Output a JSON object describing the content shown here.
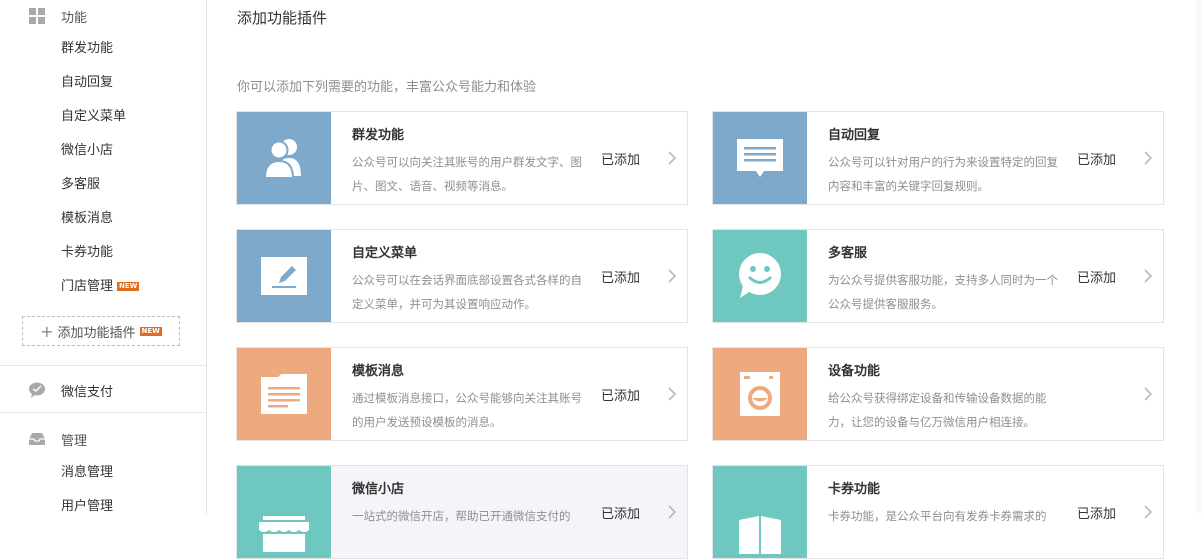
{
  "sidebar": {
    "features_title": "功能",
    "items": [
      {
        "label": "群发功能"
      },
      {
        "label": "自动回复"
      },
      {
        "label": "自定义菜单"
      },
      {
        "label": "微信小店"
      },
      {
        "label": "多客服"
      },
      {
        "label": "模板消息"
      },
      {
        "label": "卡券功能"
      },
      {
        "label": "门店管理",
        "badge": "NEW"
      }
    ],
    "add_plugin": {
      "label": "添加功能插件",
      "badge": "NEW"
    },
    "pay_title": "微信支付",
    "manage_title": "管理",
    "manage_items": [
      {
        "label": "消息管理"
      },
      {
        "label": "用户管理"
      }
    ]
  },
  "main": {
    "title": "添加功能插件",
    "subtitle": "你可以添加下列需要的功能，丰富公众号能力和体验",
    "cards": [
      {
        "title": "群发功能",
        "desc": "公众号可以向关注其账号的用户群发文字、图片、图文、语音、视频等消息。",
        "status": "已添加",
        "icon": "users-icon",
        "color": "#7fa9cb"
      },
      {
        "title": "自动回复",
        "desc": "公众号可以针对用户的行为来设置特定的回复内容和丰富的关键字回复规则。",
        "status": "已添加",
        "icon": "message-box-icon",
        "color": "#7fa9cb"
      },
      {
        "title": "自定义菜单",
        "desc": "公众号可以在会话界面底部设置各式各样的自定义菜单，并可为其设置响应动作。",
        "status": "已添加",
        "icon": "edit-icon",
        "color": "#7fa9cb"
      },
      {
        "title": "多客服",
        "desc": "为公众号提供客服功能，支持多人同时为一个公众号提供客服服务。",
        "status": "已添加",
        "icon": "smiley-chat-icon",
        "color": "#6ec8c0"
      },
      {
        "title": "模板消息",
        "desc": "通过模板消息接口，公众号能够向关注其账号的用户发送预设模板的消息。",
        "status": "已添加",
        "icon": "document-icon",
        "color": "#eeaa7f"
      },
      {
        "title": "设备功能",
        "desc": "给公众号获得绑定设备和传输设备数据的能力，让您的设备与亿万微信用户相连接。",
        "status": "",
        "icon": "washing-machine-icon",
        "color": "#eeaa7f"
      },
      {
        "title": "微信小店",
        "desc": "一站式的微信开店，帮助已开通微信支付的",
        "status": "已添加",
        "icon": "shop-icon",
        "color": "#6ec8c0"
      },
      {
        "title": "卡券功能",
        "desc": "卡券功能，是公众平台向有发券卡券需求的",
        "status": "已添加",
        "icon": "card-icon",
        "color": "#6ec8c0"
      }
    ]
  }
}
